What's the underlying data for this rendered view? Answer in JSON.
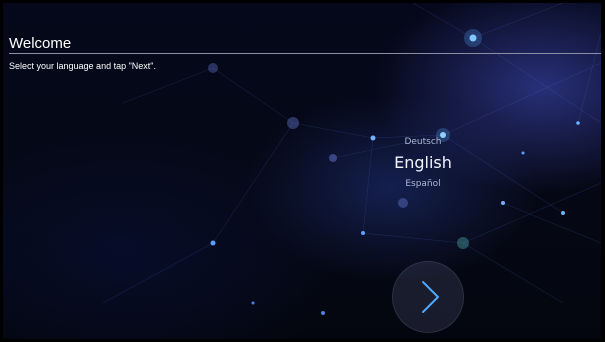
{
  "header": {
    "title": "Welcome"
  },
  "instructions": "Select your language and tap \"Next\".",
  "languages": {
    "items": [
      "Deutsch",
      "English",
      "Español"
    ],
    "selected": "English"
  },
  "next_button": {
    "icon": "chevron-right-icon"
  },
  "colors": {
    "background": "#05081a",
    "accent_glow": "#5aa0ff",
    "text": "#ffffff"
  }
}
